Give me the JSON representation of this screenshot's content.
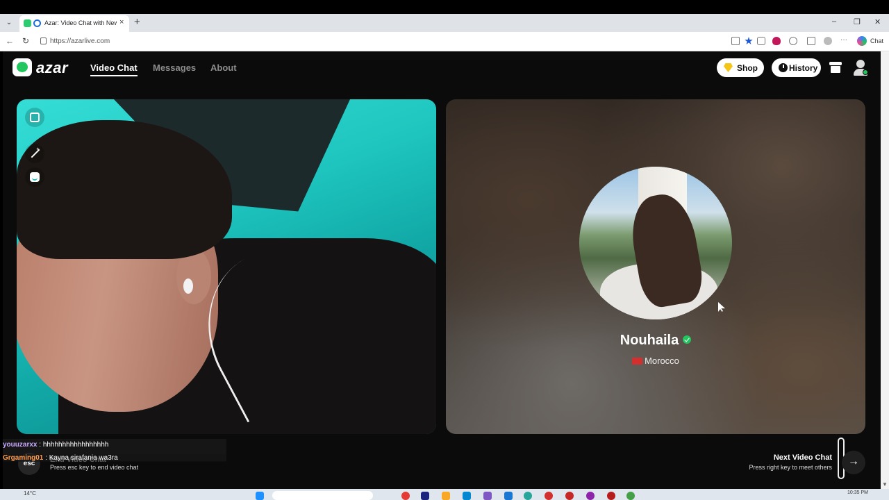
{
  "browser": {
    "tab_title": "Azar: Video Chat with New Pe",
    "tab_close": "×",
    "new_tab": "+",
    "url": "https://azarlive.com",
    "chat_extension_label": "Chat",
    "window_controls": {
      "minimize": "–",
      "restore": "❐",
      "close": "✕"
    },
    "nav": {
      "back": "←",
      "reload": "↻",
      "menu": "⌄"
    }
  },
  "site": {
    "logo_text": "azar",
    "nav": [
      {
        "label": "Video Chat",
        "active": true
      },
      {
        "label": "Messages",
        "active": false
      },
      {
        "label": "About",
        "active": false
      }
    ],
    "shop_label": "Shop",
    "history_label": "History"
  },
  "match": {
    "name": "Nouhaila",
    "country": "Morocco",
    "verified": true
  },
  "chat": [
    {
      "user": "youuzarxx",
      "separator": " : ",
      "message": "hhhhhhhhhhhhhhhhh"
    },
    {
      "user": "Grgaming01",
      "separator": " : ",
      "message": "Kayna sirafania wa3ra"
    }
  ],
  "controls": {
    "esc_key": "esc",
    "end_title": "End Video Chat",
    "end_hint": "Press esc key to end video chat",
    "next_title": "Next Video Chat",
    "next_hint": "Press right key to meet others",
    "next_arrow": "→"
  },
  "taskbar": {
    "weather": "14°C",
    "time": "10:35 PM"
  },
  "colors": {
    "accent_green": "#22c55e",
    "background": "#0b0b0b",
    "flag_red": "#d32f2f"
  }
}
